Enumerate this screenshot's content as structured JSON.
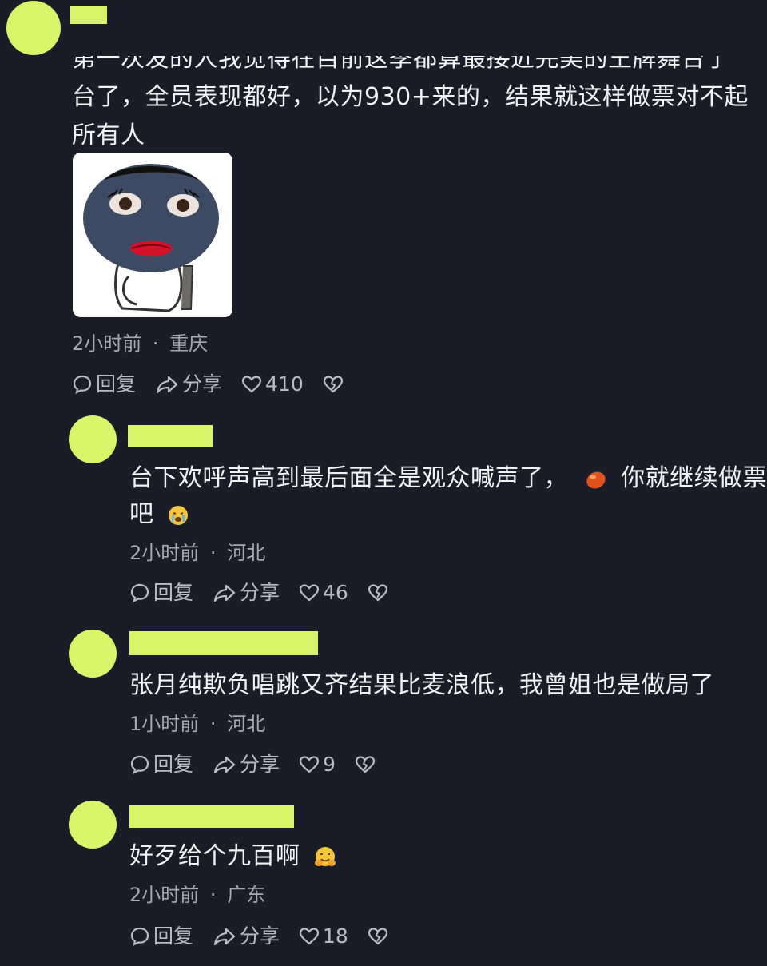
{
  "comments": [
    {
      "lines": [
        "第一次发的人我觉得在目前这季都算最接近完美的王牌舞台了",
        "台了，全员表现都好，以为930+来的，结果就这样做票对不起",
        "所有人"
      ],
      "time": "2小时前",
      "location": "重庆",
      "reply_label": "回复",
      "share_label": "分享",
      "likes": "410"
    },
    {
      "line1_a": "台下欢呼声高到最后面全是观众喊声了，",
      "line1_b": "你就继续做票",
      "line2": "吧",
      "time": "2小时前",
      "location": "河北",
      "reply_label": "回复",
      "share_label": "分享",
      "likes": "46"
    },
    {
      "text": "张月纯欺负唱跳又齐结果比麦浪低，我曾姐也是做局了",
      "time": "1小时前",
      "location": "河北",
      "reply_label": "回复",
      "share_label": "分享",
      "likes": "9"
    },
    {
      "text": "好歹给个九百啊",
      "time": "2小时前",
      "location": "广东",
      "reply_label": "回复",
      "share_label": "分享",
      "likes": "18"
    }
  ],
  "separator": "·",
  "icons": {
    "reply": "reply-bubble-icon",
    "share": "share-arrow-icon",
    "like": "heart-icon",
    "dislike": "broken-heart-icon",
    "sticker": "meme-face-sticker",
    "emoji_mango": "mango-emoji-icon",
    "emoji_cry": "crying-face-emoji-icon",
    "emoji_hug": "hugging-face-emoji-icon"
  },
  "colors": {
    "background": "#1a1c27",
    "avatar": "#d8f56a",
    "text": "#f2f3f5",
    "meta": "#a6a8b3"
  }
}
